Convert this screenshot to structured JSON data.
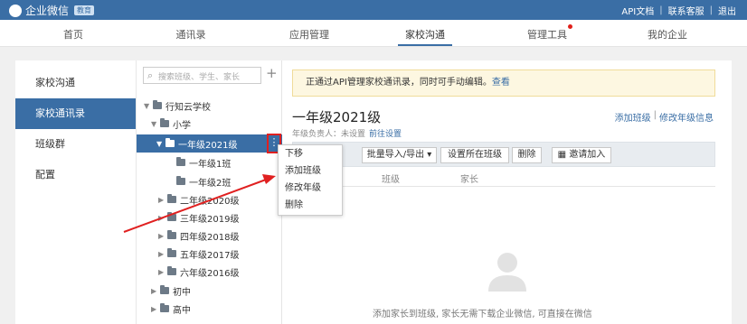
{
  "app": {
    "name": "企业微信",
    "edition": "教育"
  },
  "top_links": [
    "API文档",
    "联系客服",
    "退出"
  ],
  "nav": {
    "tabs": [
      "首页",
      "通讯录",
      "应用管理",
      "家校沟通",
      "管理工具",
      "我的企业"
    ],
    "active": "家校沟通"
  },
  "sidebar": {
    "items": [
      "家校沟通",
      "家校通讯录",
      "班级群",
      "配置"
    ],
    "active": "家校通讯录"
  },
  "tree": {
    "search_placeholder": "搜索班级、学生、家长",
    "add_symbol": "+",
    "nodes": [
      "行知云学校",
      "小学",
      "一年级2021级",
      "一年级1班",
      "一年级2班",
      "二年级2020级",
      "三年级2019级",
      "四年级2018级",
      "五年级2017级",
      "六年级2016级",
      "初中",
      "高中"
    ],
    "selected": "一年级2021级"
  },
  "context_menu": {
    "items": [
      "下移",
      "添加班级",
      "修改年级",
      "删除"
    ]
  },
  "notice": {
    "text": "正通过API管理家校通讯录，同时可手动编辑。",
    "link": "查看"
  },
  "grade": {
    "title": "一年级2021级",
    "owner_label": "年级负责人：未设置",
    "owner_link": "前往设置",
    "add_class": "添加班级",
    "edit_grade": "修改年级信息"
  },
  "toolbar": {
    "import_export": "批量导入/导出",
    "set_class": "设置所在班级",
    "delete": "删除",
    "invite": "邀请加入"
  },
  "table": {
    "headers": [
      "班级",
      "家长"
    ]
  },
  "empty_text": "添加家长到班级, 家长无需下载企业微信, 可直接在微信",
  "colors": {
    "brand": "#3a6ea5",
    "highlight": "#e02020"
  }
}
